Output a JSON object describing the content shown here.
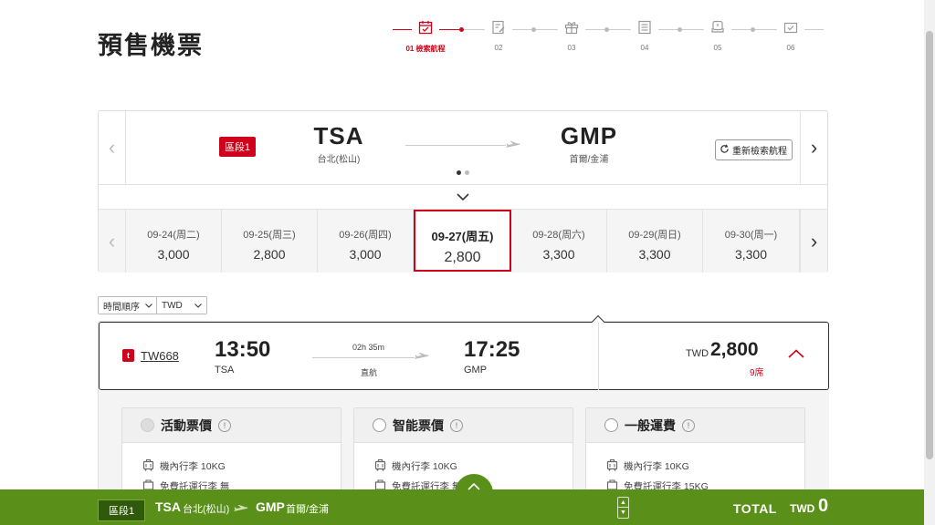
{
  "page": {
    "title": "預售機票"
  },
  "stepper": {
    "steps": [
      {
        "label": "01 檢索航程",
        "icon": "calendar-icon",
        "active": true
      },
      {
        "label": "02",
        "icon": "edit-document-icon"
      },
      {
        "label": "03",
        "icon": "gift-icon"
      },
      {
        "label": "04",
        "icon": "document-list-icon"
      },
      {
        "label": "05",
        "icon": "seat-icon"
      },
      {
        "label": "06",
        "icon": "check-card-icon"
      }
    ]
  },
  "route": {
    "segment_label": "區段1",
    "from": {
      "code": "TSA",
      "city": "台北(松山)"
    },
    "to": {
      "code": "GMP",
      "city": "首爾/金浦"
    },
    "refresh_label": "重新檢索航程"
  },
  "dates": [
    {
      "date": "09-24(周二)",
      "price": "3,000"
    },
    {
      "date": "09-25(周三)",
      "price": "2,800"
    },
    {
      "date": "09-26(周四)",
      "price": "3,000"
    },
    {
      "date": "09-27(周五)",
      "price": "2,800",
      "selected": true
    },
    {
      "date": "09-28(周六)",
      "price": "3,300"
    },
    {
      "date": "09-29(周日)",
      "price": "3,300"
    },
    {
      "date": "09-30(周一)",
      "price": "3,300"
    }
  ],
  "filters": {
    "sort": "時間順序",
    "currency": "TWD"
  },
  "flight": {
    "airline_logo": "t",
    "number": "TW668",
    "depart_time": "13:50",
    "depart_code": "TSA",
    "arrive_time": "17:25",
    "arrive_code": "GMP",
    "duration": "02h 35m",
    "type": "直航",
    "currency": "TWD",
    "price": "2,800",
    "seats": "9席"
  },
  "fares": [
    {
      "name": "活動票價",
      "disabled": true,
      "cabin_bag": "機內行李 10KG",
      "checked_bag": "免費託運行李 無"
    },
    {
      "name": "智能票價",
      "disabled": false,
      "cabin_bag": "機內行李 10KG",
      "checked_bag": "免費託運行李 無"
    },
    {
      "name": "一般運費",
      "disabled": false,
      "cabin_bag": "機內行李 10KG",
      "checked_bag": "免費託運行李 15KG"
    }
  ],
  "bottom": {
    "segment_label": "區段1",
    "from_code": "TSA",
    "from_city": "台北(松山)",
    "to_code": "GMP",
    "to_city": "首爾/金浦",
    "total_label": "TOTAL",
    "currency": "TWD",
    "amount": "0"
  },
  "colors": {
    "accent": "#d0021b",
    "bar": "#5a8f1a"
  }
}
